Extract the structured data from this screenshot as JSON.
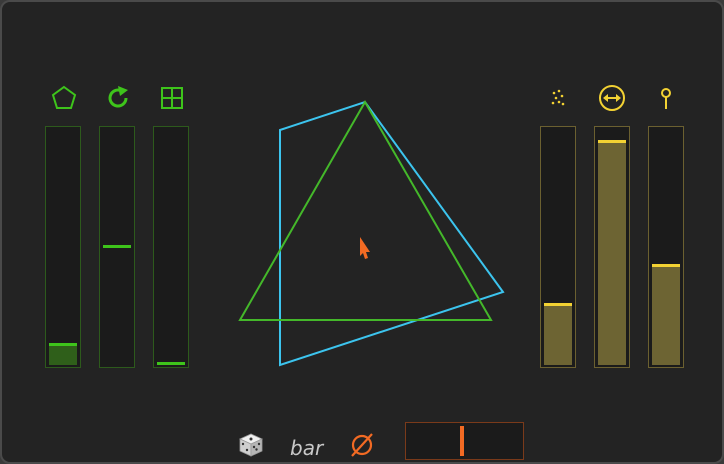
{
  "colors": {
    "green_accent": "#3ec41b",
    "gold_accent": "#f3d233",
    "cyan_accent": "#3cc4ee",
    "orange_accent": "#f26a23"
  },
  "left_sliders": [
    {
      "icon": "pentagon-icon",
      "level": 0.08
    },
    {
      "icon": "rotate-icon",
      "level": 0.5
    },
    {
      "icon": "grid-icon",
      "level": 0.0
    }
  ],
  "right_sliders": [
    {
      "icon": "scatter-dots-icon",
      "level": 0.25
    },
    {
      "icon": "horizontal-arrows-icon",
      "level": 0.95
    },
    {
      "icon": "pin-icon",
      "level": 0.42
    }
  ],
  "bottom": {
    "bar_label": "bar",
    "dice_icon": "dice-icon",
    "phase_icon": "empty-set-icon",
    "offset_level": 0.48
  }
}
